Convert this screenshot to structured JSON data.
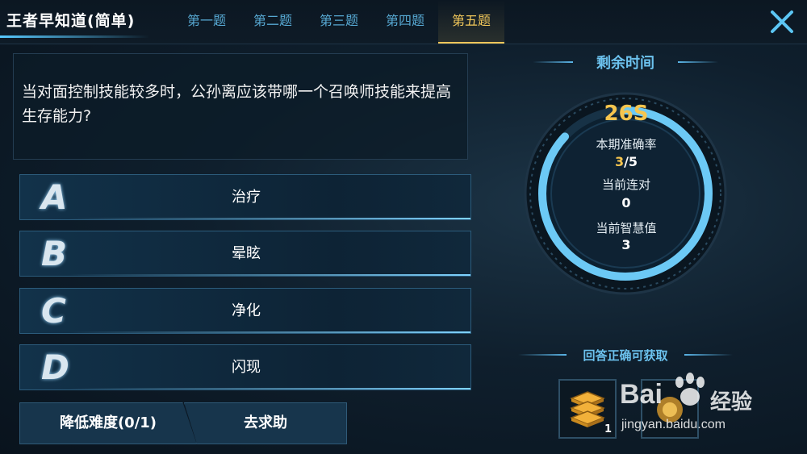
{
  "header": {
    "title": "王者早知道(简单)",
    "tabs": [
      {
        "label": "第一题",
        "active": false
      },
      {
        "label": "第二题",
        "active": false
      },
      {
        "label": "第三题",
        "active": false
      },
      {
        "label": "第四题",
        "active": false
      },
      {
        "label": "第五题",
        "active": true
      }
    ],
    "close_icon": "close-icon"
  },
  "question": {
    "text": "当对面控制技能较多时，公孙离应该带哪一个召唤师技能来提高生存能力?"
  },
  "options": [
    {
      "letter": "A",
      "label": "治疗"
    },
    {
      "letter": "B",
      "label": "晕眩"
    },
    {
      "letter": "C",
      "label": "净化"
    },
    {
      "letter": "D",
      "label": "闪现"
    }
  ],
  "buttons": {
    "lower_difficulty": "降低难度(0/1)",
    "ask_help": "去求助"
  },
  "timer": {
    "header": "剩余时间",
    "countdown": "26S",
    "progress_fraction": 0.87
  },
  "stats": {
    "accuracy_label": "本期准确率",
    "accuracy_correct": "3",
    "accuracy_total": "/5",
    "streak_label": "当前连对",
    "streak_value": "0",
    "wisdom_label": "当前智慧值",
    "wisdom_value": "3"
  },
  "rewards": {
    "header": "回答正确可获取",
    "items": [
      {
        "icon": "coin-stack-icon",
        "count": "1"
      },
      {
        "icon": "reward-item-icon",
        "count": ""
      }
    ]
  },
  "watermark": {
    "logo": "Bai",
    "logo_cn": "经验",
    "url": "jingyan.baidu.com"
  },
  "colors": {
    "accent_gold": "#f6c54e",
    "accent_blue": "#57a9d3",
    "ring_blue": "#6cc9f5"
  }
}
